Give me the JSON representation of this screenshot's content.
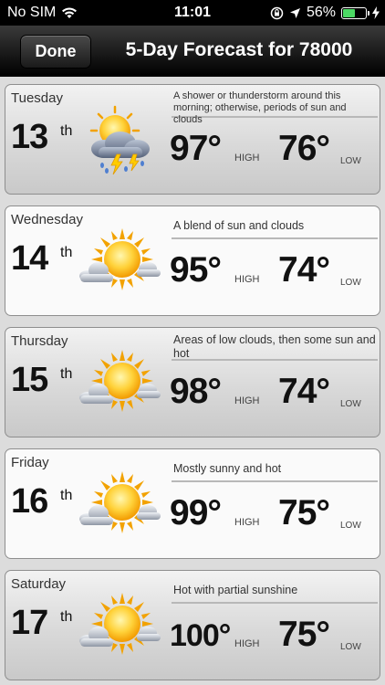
{
  "status_bar": {
    "carrier": "No SIM",
    "time": "11:01",
    "battery_percent": "56%",
    "battery_level": 0.56,
    "icons": [
      "wifi-icon",
      "orientation-lock-icon",
      "location-arrow-icon",
      "battery-icon",
      "charging-bolt-icon"
    ]
  },
  "nav": {
    "done_label": "Done",
    "title": "5-Day Forecast for 78000"
  },
  "forecast": [
    {
      "day": "Tuesday",
      "date": "13",
      "suffix": "th",
      "description": "A shower or thunderstorm around this morning; otherwise, periods of sun and clouds",
      "icon": "thunderstorm-sun-icon",
      "high": "97°",
      "high_label": "HIGH",
      "low": "76°",
      "low_label": "LOW"
    },
    {
      "day": "Wednesday",
      "date": "14",
      "suffix": "th",
      "description": "A blend of sun and clouds",
      "icon": "sun-cloud-icon",
      "high": "95°",
      "high_label": "HIGH",
      "low": "74°",
      "low_label": "LOW"
    },
    {
      "day": "Thursday",
      "date": "15",
      "suffix": "th",
      "description": "Areas of low clouds, then some sun and hot",
      "icon": "sun-cloud-icon",
      "high": "98°",
      "high_label": "HIGH",
      "low": "74°",
      "low_label": "LOW"
    },
    {
      "day": "Friday",
      "date": "16",
      "suffix": "th",
      "description": "Mostly sunny and hot",
      "icon": "sun-cloud-icon",
      "high": "99°",
      "high_label": "HIGH",
      "low": "75°",
      "low_label": "LOW"
    },
    {
      "day": "Saturday",
      "date": "17",
      "suffix": "th",
      "description": "Hot with partial sunshine",
      "icon": "sun-cloud-icon",
      "high": "100°",
      "high_label": "HIGH",
      "low": "75°",
      "low_label": "LOW"
    }
  ],
  "colors": {
    "sun": "#f7b500",
    "sun_core": "#ffe25a",
    "cloud": "#b0b6c0",
    "battery": "#4cd964"
  }
}
